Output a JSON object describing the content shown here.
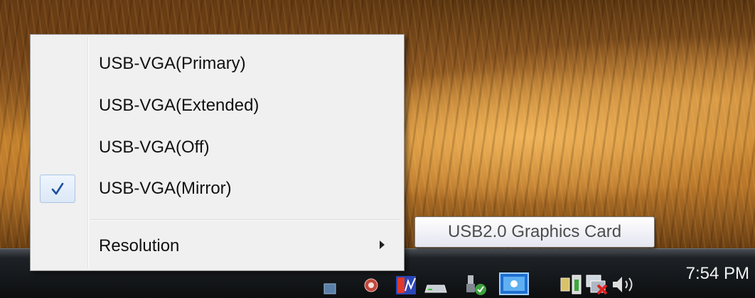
{
  "menu": {
    "items": [
      {
        "label": "USB-VGA(Primary)",
        "checked": false
      },
      {
        "label": "USB-VGA(Extended)",
        "checked": false
      },
      {
        "label": "USB-VGA(Off)",
        "checked": false
      },
      {
        "label": "USB-VGA(Mirror)",
        "checked": true
      }
    ],
    "submenu_item": {
      "label": "Resolution"
    }
  },
  "tooltip": {
    "text": "USB2.0 Graphics Card"
  },
  "taskbar": {
    "clock": "7:54 PM",
    "tray_icons": [
      "network-icon",
      "security-shield-icon",
      "graphics-monitor-icon",
      "removable-drive-icon",
      "usb-device-check-icon",
      "usb-graphics-card-icon",
      "power-plug-icon",
      "network-disconnected-icon",
      "volume-icon"
    ]
  },
  "colors": {
    "check": "#1c4f9c",
    "menu_bg": "#f0f0f0",
    "taskbar": "#0c0e10"
  }
}
